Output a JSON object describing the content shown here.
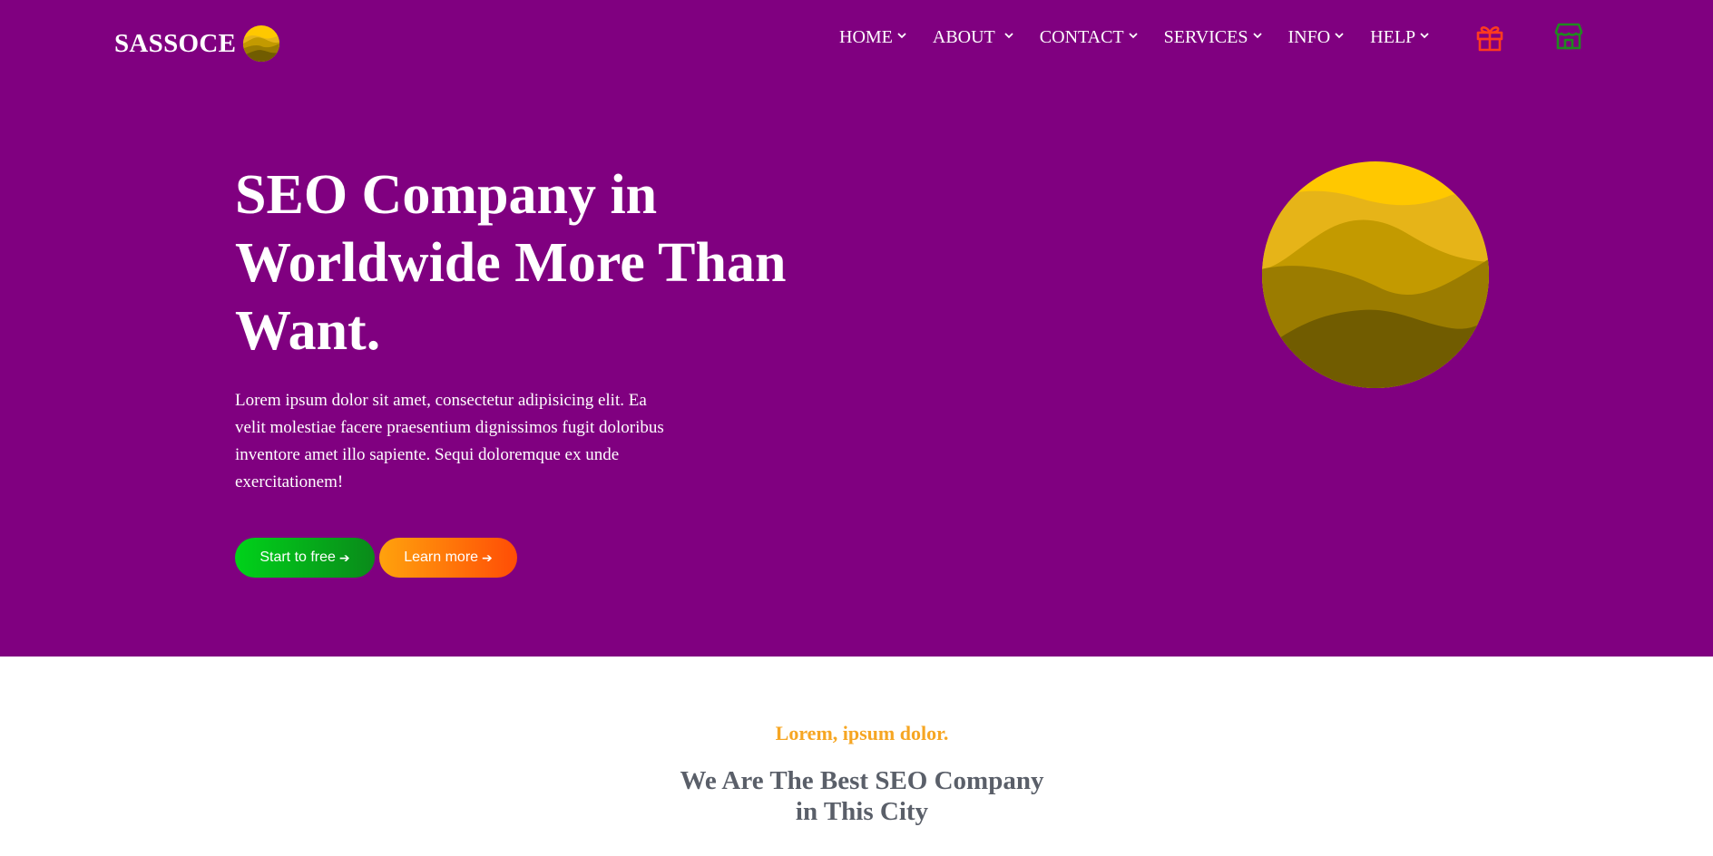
{
  "header": {
    "brand": "SASSOCE",
    "nav": [
      {
        "label": "HOME"
      },
      {
        "label": "ABOUT"
      },
      {
        "label": "CONTACT"
      },
      {
        "label": "SERVICES"
      },
      {
        "label": "INFO"
      },
      {
        "label": "HELP"
      }
    ],
    "icons": {
      "gift": {
        "name": "gift-icon",
        "color": "#ff3b1f"
      },
      "store": {
        "name": "store-icon",
        "color": "#1f8a1f"
      }
    }
  },
  "hero": {
    "background": "#800080",
    "title": "SEO Company in Worldwide More Than Want.",
    "description": "Lorem ipsum dolor sit amet, consectetur adipisicing elit. Ea velit molestiae facere praesentium dignissimos fugit doloribus inventore amet illo sapiente. Sequi doloremque ex unde exercitationem!",
    "buttons": {
      "start": "Start to free",
      "learn": "Learn more"
    }
  },
  "section": {
    "eyebrow": "Lorem, ipsum dolor.",
    "title_line1": "We Are The Best SEO Company",
    "title_line2": "in This City"
  },
  "colors": {
    "accent_orange": "#f6a623",
    "heading_gray": "#5a5f69",
    "gold": "#ffc800"
  }
}
